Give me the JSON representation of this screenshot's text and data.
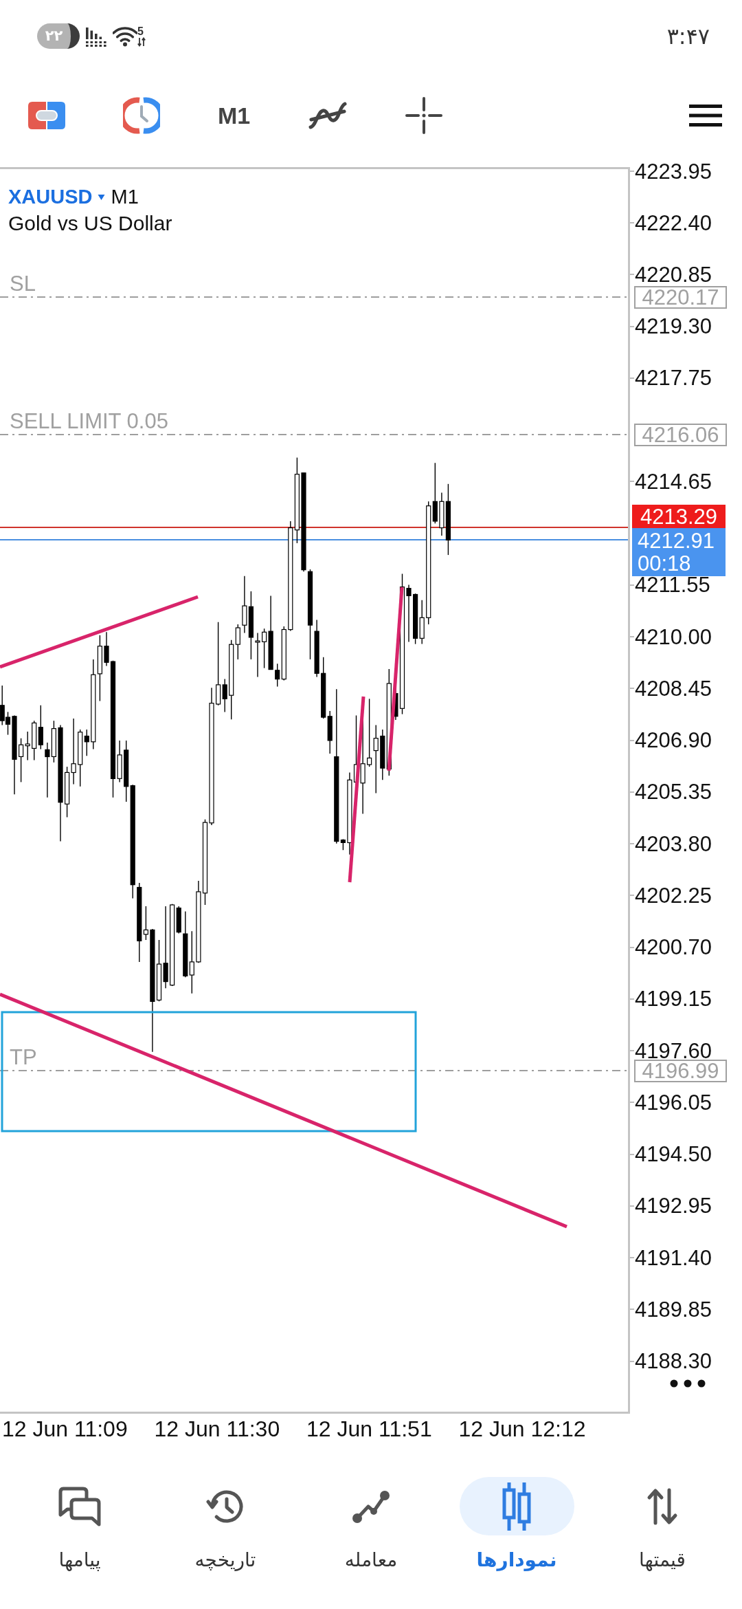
{
  "status_bar": {
    "battery": "۲۲",
    "wifi_standard": "5",
    "time": "۳:۴۷"
  },
  "toolbar": {
    "timeframe": "M1"
  },
  "chart": {
    "symbol": "XAUUSD",
    "timeframe": "M1",
    "description": "Gold vs US Dollar",
    "order_levels": [
      {
        "label": "SL",
        "price": "4220.17"
      },
      {
        "label": "SELL LIMIT 0.05",
        "price": "4216.06"
      },
      {
        "label": "TP",
        "price": "4196.99"
      }
    ],
    "ask_price": "4213.29",
    "bid_price": "4212.91",
    "bar_countdown": "00:18",
    "price_axis": [
      "4223.95",
      "4222.40",
      "4220.85",
      "4219.30",
      "4217.75",
      "4214.65",
      "4211.55",
      "4210.00",
      "4208.45",
      "4206.90",
      "4205.35",
      "4203.80",
      "4202.25",
      "4200.70",
      "4199.15",
      "4197.60",
      "4196.05",
      "4194.50",
      "4192.95",
      "4191.40",
      "4189.85",
      "4188.30"
    ],
    "time_axis": [
      "12 Jun 11:09",
      "12 Jun 11:30",
      "12 Jun 11:51",
      "12 Jun 12:12"
    ]
  },
  "bottom_nav": [
    {
      "label": "قیمتها",
      "selected": false
    },
    {
      "label": "نمودارها",
      "selected": true
    },
    {
      "label": "معامله",
      "selected": false
    },
    {
      "label": "تاریخچه",
      "selected": false
    },
    {
      "label": "پیامها",
      "selected": false
    }
  ]
}
